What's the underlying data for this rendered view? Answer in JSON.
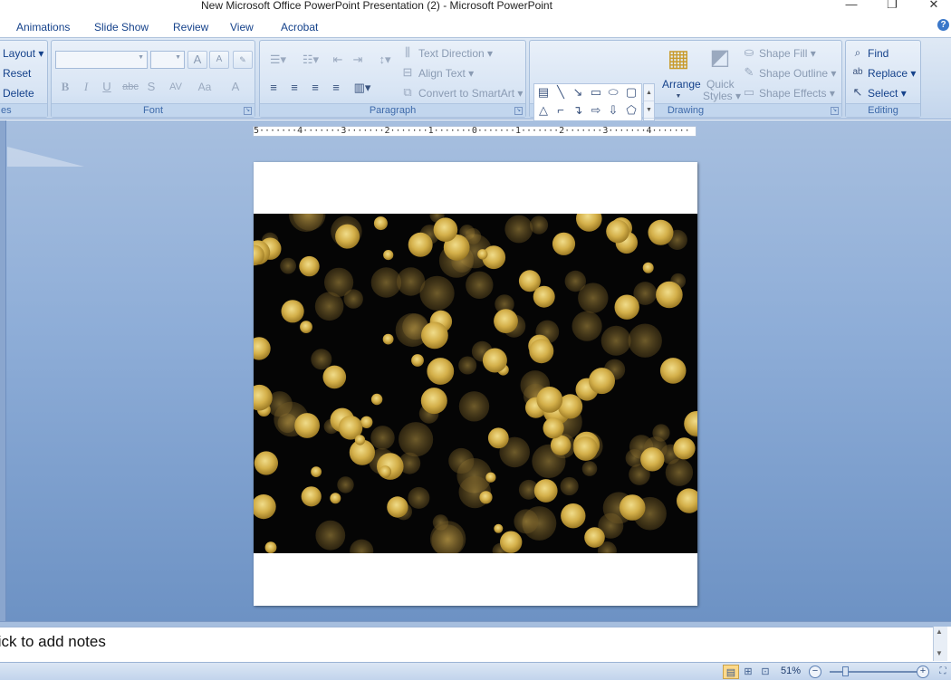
{
  "window": {
    "title": "New Microsoft Office PowerPoint Presentation (2) - Microsoft PowerPoint",
    "minimize": "—",
    "restore": "❐",
    "close": "✕"
  },
  "tabs": [
    "Animations",
    "Slide Show",
    "Review",
    "View",
    "Acrobat"
  ],
  "help_label": "?",
  "slides_group": {
    "layout": "Layout",
    "reset": "Reset",
    "delete": "Delete",
    "label": "es"
  },
  "font_group": {
    "label": "Font",
    "font_name": "",
    "font_size": "",
    "grow": "A",
    "shrink": "A",
    "bold": "B",
    "italic": "I",
    "underline": "U",
    "strike": "abc",
    "shadow": "S",
    "spacing": "AV",
    "case": "Aa",
    "color": "A"
  },
  "paragraph_group": {
    "label": "Paragraph",
    "text_direction": "Text Direction",
    "align_text": "Align Text",
    "convert_smartart": "Convert to SmartArt"
  },
  "drawing_group": {
    "label": "Drawing",
    "arrange": "Arrange",
    "quick_styles_1": "Quick",
    "quick_styles_2": "Styles",
    "shape_fill": "Shape Fill",
    "shape_outline": "Shape Outline",
    "shape_effects": "Shape Effects"
  },
  "editing_group": {
    "label": "Editing",
    "find": "Find",
    "replace": "Replace",
    "select": "Select"
  },
  "ruler_text": "5·······4·······3·······2·······1·······0·······1·······2·······3·······4·······",
  "notes_placeholder": "lick to add notes",
  "status": {
    "zoom": "51%",
    "zoom_out": "−",
    "zoom_in": "+"
  },
  "colors": {
    "ribbon": "#cfdef0",
    "workarea": "#8faed8",
    "bokeh": "#d9b850"
  }
}
